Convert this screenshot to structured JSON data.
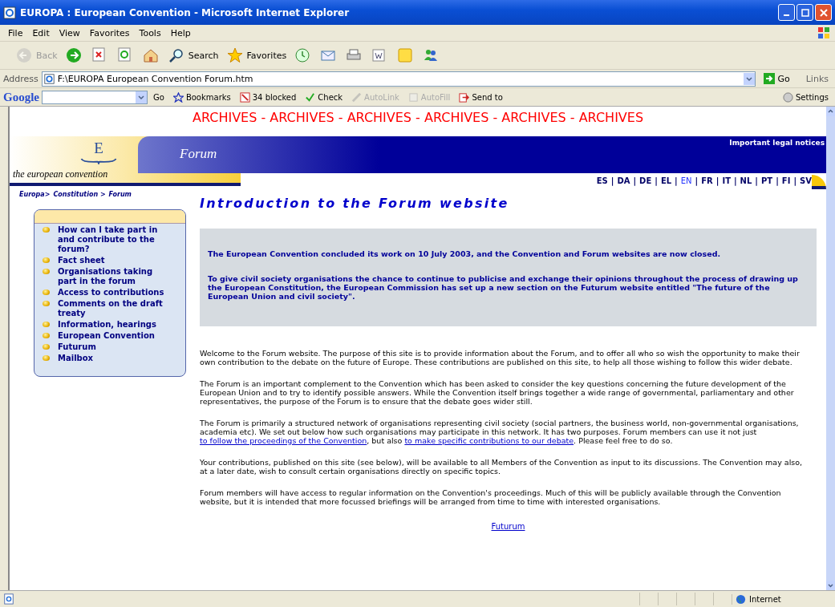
{
  "window": {
    "title": "EUROPA : European Convention - Microsoft Internet Explorer"
  },
  "menu": [
    "File",
    "Edit",
    "View",
    "Favorites",
    "Tools",
    "Help"
  ],
  "toolbar": [
    {
      "kind": "back",
      "label": "Back",
      "disabled": true
    },
    {
      "kind": "forward",
      "disabled": false
    },
    {
      "kind": "stop",
      "disabled": false
    },
    {
      "kind": "refresh",
      "disabled": false
    },
    {
      "kind": "home",
      "disabled": false
    },
    {
      "kind": "search",
      "label": "Search",
      "disabled": false
    },
    {
      "kind": "favorites",
      "label": "Favorites",
      "disabled": false
    },
    {
      "kind": "history",
      "disabled": false
    },
    {
      "kind": "mail",
      "disabled": false
    },
    {
      "kind": "print",
      "disabled": false
    },
    {
      "kind": "edit",
      "disabled": false
    },
    {
      "kind": "note",
      "disabled": false
    },
    {
      "kind": "messenger",
      "disabled": false
    }
  ],
  "address_bar": {
    "label": "Address",
    "value": "F:\\EUROPA  European Convention Forum.htm",
    "go": "Go",
    "links": "Links"
  },
  "google_bar": {
    "logo": "Google",
    "go": "Go",
    "items": [
      {
        "kind": "bookmarks",
        "label": "Bookmarks",
        "disabled": false
      },
      {
        "kind": "blocked",
        "label": "34 blocked",
        "disabled": false
      },
      {
        "kind": "check",
        "label": "Check",
        "disabled": false
      },
      {
        "kind": "autolink",
        "label": "AutoLink",
        "disabled": true
      },
      {
        "kind": "autofill",
        "label": "AutoFill",
        "disabled": true
      },
      {
        "kind": "sendto",
        "label": "Send to",
        "disabled": false
      }
    ],
    "settings": "Settings"
  },
  "page": {
    "banner": "ARCHIVES - ARCHIVES - ARCHIVES - ARCHIVES - ARCHIVES - ARCHIVES",
    "logo_letter": "E",
    "site_name": "Forum",
    "tagline": "the european convention",
    "legal": "Important legal notices",
    "separator": "|",
    "languages": [
      {
        "code": "ES",
        "selected": false
      },
      {
        "code": "DA",
        "selected": false
      },
      {
        "code": "DE",
        "selected": false
      },
      {
        "code": "EL",
        "selected": false
      },
      {
        "code": "EN",
        "selected": true
      },
      {
        "code": "FR",
        "selected": false
      },
      {
        "code": "IT",
        "selected": false
      },
      {
        "code": "NL",
        "selected": false
      },
      {
        "code": "PT",
        "selected": false
      },
      {
        "code": "FI",
        "selected": false
      },
      {
        "code": "SV",
        "selected": false
      }
    ],
    "breadcrumb": [
      "Europa>",
      "Constitution >",
      "Forum"
    ],
    "sidebar": [
      "How can I take part in and contribute to the forum?",
      "Fact sheet",
      "Organisations taking part in the forum",
      "Access to contributions",
      "Comments on the draft treaty",
      "Information, hearings",
      "European Convention",
      "Futurum",
      "Mailbox"
    ],
    "heading": "Introduction to the Forum website",
    "notice": [
      "The European Convention concluded its work on 10 July 2003, and the Convention and Forum websites are now closed.",
      "To give civil society organisations the chance to continue to publicise and exchange their opinions throughout the process of drawing up the European Constitution, the European Commission has set up a new section on the Futurum website entitled \"The future of the European Union and civil society\"."
    ],
    "paragraphs": [
      [
        {
          "kind": "text",
          "text": "Welcome to the Forum website. The purpose of this site is to provide information about the Forum, and to offer all who so wish the opportunity to make their own contribution to the debate on the future of Europe. These contributions are published on this site, to help all those wishing to follow this wider debate."
        }
      ],
      [
        {
          "kind": "text",
          "text": "The Forum is an important complement to the Convention which has been asked to consider the key questions concerning the future development of the European Union and to try to identify possible answers. While the Convention itself brings together a wide range of governmental, parliamentary and other representatives, the purpose of the Forum is to ensure that the debate goes wider still."
        }
      ],
      [
        {
          "kind": "text",
          "text": "The Forum is primarily a structured network of organisations representing civil society (social partners, the business world, non-governmental organisations, academia etc). We set out below how such organisations may participate in this network. It has two purposes. Forum members can use it not just "
        },
        {
          "kind": "link",
          "text": "to follow the proceedings of the Convention"
        },
        {
          "kind": "text",
          "text": ", but also "
        },
        {
          "kind": "link",
          "text": "to make specific contributions to our debate"
        },
        {
          "kind": "text",
          "text": ". Please feel free to do so."
        }
      ],
      [
        {
          "kind": "text",
          "text": "Your contributions, published on this site (see below), will be available to all Members of the Convention as input to its discussions. The Convention may also, at a later date, wish to consult certain organisations directly on specific topics."
        }
      ],
      [
        {
          "kind": "text",
          "text": "Forum members will have access to regular information on the Convention's proceedings. Much of this will be publicly available through the Convention website, but it is intended that more focussed briefings will be arranged from time to time with interested organisations."
        }
      ]
    ],
    "footer_link": "Futurum"
  },
  "status_bar": {
    "zone": "Internet"
  }
}
